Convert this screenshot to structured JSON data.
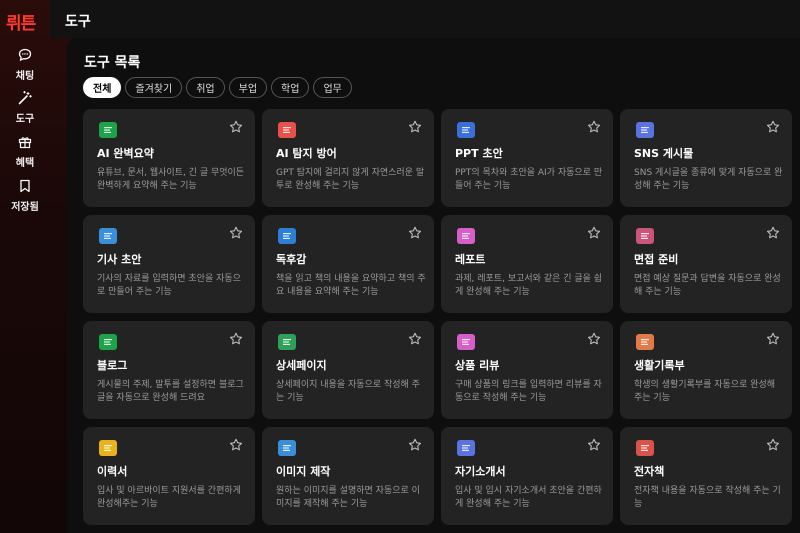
{
  "app": {
    "logo": "뤼튼"
  },
  "sidebar": {
    "items": [
      {
        "label": "채팅",
        "icon": "chat-icon"
      },
      {
        "label": "도구",
        "icon": "magic-wand-icon"
      },
      {
        "label": "혜택",
        "icon": "gift-icon"
      },
      {
        "label": "저장됨",
        "icon": "bookmark-icon"
      }
    ]
  },
  "header": {
    "title": "도구"
  },
  "main": {
    "section_title": "도구 목록",
    "filters": [
      {
        "label": "전체",
        "active": true
      },
      {
        "label": "즐겨찾기",
        "active": false
      },
      {
        "label": "취업",
        "active": false
      },
      {
        "label": "부업",
        "active": false
      },
      {
        "label": "학업",
        "active": false
      },
      {
        "label": "업무",
        "active": false
      }
    ],
    "tools": [
      {
        "title": "AI 완벽요약",
        "desc": "유튜브, 문서, 웹사이트, 긴 글 무엇이든 완벽하게 요약해 주는 기능",
        "icon_color": "#1fa34a",
        "icon": "summary-icon"
      },
      {
        "title": "AI 탐지 방어",
        "desc": "GPT 탐지에 걸리지 않게 자연스러운 말투로 완성해 주는 기능",
        "icon_color": "#e8504a",
        "icon": "shield-icon"
      },
      {
        "title": "PPT 초안",
        "desc": "PPT의 목차와 초안을 AI가 자동으로 만들어 주는 기능",
        "icon_color": "#3b6fd9",
        "icon": "presentation-icon"
      },
      {
        "title": "SNS 게시물",
        "desc": "SNS 게시글을 종류에 맞게 자동으로 완성해 주는 기능",
        "icon_color": "#5a73e0",
        "icon": "phone-icon"
      },
      {
        "title": "기사 초안",
        "desc": "기사의 자료를 입력하면 초안을 자동으로 만들어 주는 기능",
        "icon_color": "#3a8fd9",
        "icon": "newspaper-icon"
      },
      {
        "title": "독후감",
        "desc": "책을 읽고 책의 내용을 요약하고 책의 주요 내용을 요약해 주는 기능",
        "icon_color": "#2d7fd6",
        "icon": "book-icon"
      },
      {
        "title": "레포트",
        "desc": "과제, 레포트, 보고서와 같은 긴 글을 쉽게 완성해 주는 기능",
        "icon_color": "#d65ec9",
        "icon": "report-icon"
      },
      {
        "title": "면접 준비",
        "desc": "면접 예상 질문과 답변을 자동으로 완성해 주는 기능",
        "icon_color": "#c9567a",
        "icon": "briefcase-icon"
      },
      {
        "title": "블로그",
        "desc": "게시물의 주제, 말투를 설정하면 블로그 글을 자동으로 완성해 드려요",
        "icon_color": "#1fa34a",
        "icon": "blog-icon"
      },
      {
        "title": "상세페이지",
        "desc": "상세페이지 내용을 자동으로 작성해 주는 기능",
        "icon_color": "#2fa05a",
        "icon": "page-icon"
      },
      {
        "title": "상품 리뷰",
        "desc": "구매 상품의 링크를 입력하면 리뷰를 자동으로 작성해 주는 기능",
        "icon_color": "#d65ec9",
        "icon": "review-icon"
      },
      {
        "title": "생활기록부",
        "desc": "학생의 생활기록부를 자동으로 완성해 주는 기능",
        "icon_color": "#e07a4a",
        "icon": "school-icon"
      },
      {
        "title": "이력서",
        "desc": "입사 및 아르바이트 지원서를 간편하게 완성해주는 기능",
        "icon_color": "#e8b21a",
        "icon": "resume-icon"
      },
      {
        "title": "이미지 제작",
        "desc": "원하는 이미지를 설명하면 자동으로 이미지를 제작해 주는 기능",
        "icon_color": "#3a8fd9",
        "icon": "image-icon"
      },
      {
        "title": "자기소개서",
        "desc": "입사 및 입시 자기소개서 초안을 간편하게 완성해 주는 기능",
        "icon_color": "#5a73e0",
        "icon": "profile-icon"
      },
      {
        "title": "전자책",
        "desc": "전자책 내용을 자동으로 작성해 주는 기능",
        "icon_color": "#d9534a",
        "icon": "ebook-icon"
      }
    ]
  }
}
